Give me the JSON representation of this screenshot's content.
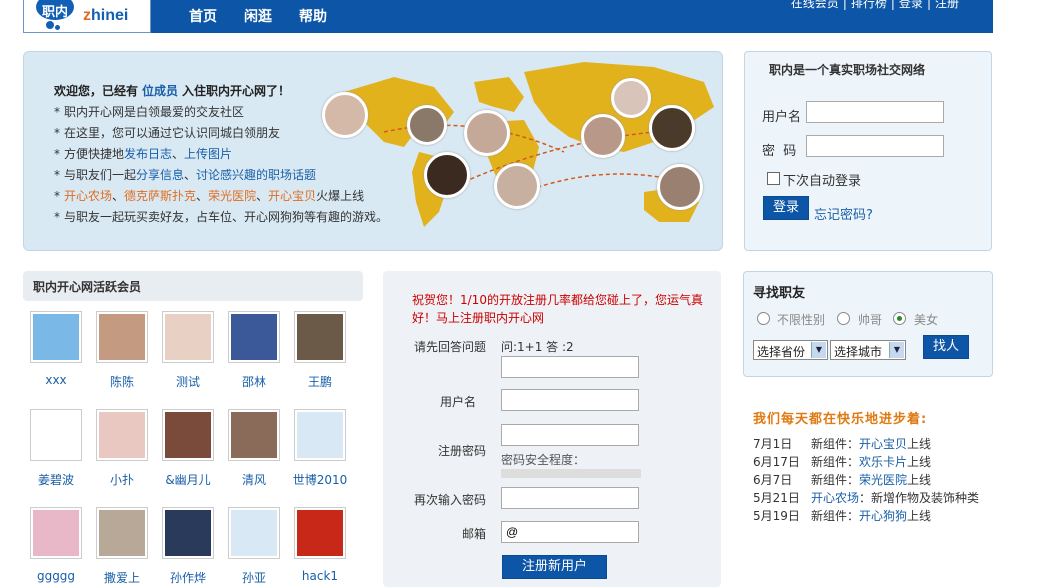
{
  "header": {
    "logo_cn": "职内",
    "logo_en_prefix": "z",
    "logo_en_rest": "hinei",
    "nav": [
      "首页",
      "闲逛",
      "帮助"
    ],
    "toplinks": [
      "在线会员",
      "排行榜",
      "登录",
      "注册"
    ]
  },
  "banner": {
    "welcome_prefix": "欢迎您，已经有",
    "welcome_count": "位成员",
    "welcome_suffix": "入住职内开心网了！",
    "bullet": "*",
    "features": [
      {
        "parts": [
          {
            "t": "职内开心网是白领最爱的交友社区",
            "c": ""
          }
        ]
      },
      {
        "parts": [
          {
            "t": "在这里，您可以通过它认识同城白领朋友",
            "c": ""
          }
        ]
      },
      {
        "parts": [
          {
            "t": "方便快捷地",
            "c": ""
          },
          {
            "t": "发布日志",
            "c": "lk"
          },
          {
            "t": "、",
            "c": ""
          },
          {
            "t": "上传图片",
            "c": "lk"
          }
        ]
      },
      {
        "parts": [
          {
            "t": "与职友们一起",
            "c": ""
          },
          {
            "t": "分享信息",
            "c": "lk"
          },
          {
            "t": "、",
            "c": ""
          },
          {
            "t": "讨论感兴趣的职场话题",
            "c": "lk"
          }
        ]
      },
      {
        "parts": [
          {
            "t": "开心农场",
            "c": "or"
          },
          {
            "t": "、",
            "c": ""
          },
          {
            "t": "德克萨斯扑克",
            "c": "or"
          },
          {
            "t": "、",
            "c": ""
          },
          {
            "t": "荣光医院",
            "c": "or"
          },
          {
            "t": "、",
            "c": ""
          },
          {
            "t": "开心宝贝",
            "c": "or"
          },
          {
            "t": "火爆上线",
            "c": ""
          }
        ]
      },
      {
        "parts": [
          {
            "t": "与职友一起玩买卖好友，占车位、开心网狗狗等有趣的游戏。",
            "c": ""
          }
        ]
      }
    ]
  },
  "login": {
    "title": "职内是一个真实职场社交网络",
    "username_label": "用户名",
    "password_label": "密  码",
    "username_value": "",
    "password_value": "",
    "auto_login": "下次自动登录",
    "login_button": "登录",
    "forgot": "忘记密码?"
  },
  "members": {
    "title": "职内开心网活跃会员",
    "list": [
      {
        "name": "xxx",
        "color": "#7ab8e8"
      },
      {
        "name": "陈陈",
        "color": "#c49a80"
      },
      {
        "name": "测试",
        "color": "#e8d0c4"
      },
      {
        "name": "邵林",
        "color": "#3b5998"
      },
      {
        "name": "王鹏",
        "color": "#6b5a48"
      },
      {
        "name": "姜碧波",
        "color": "#ffffff"
      },
      {
        "name": "小扑",
        "color": "#e8c8c0"
      },
      {
        "name": "&幽月儿",
        "color": "#7a4a3a"
      },
      {
        "name": "清风",
        "color": "#8a6a58"
      },
      {
        "name": "世博2010",
        "color": "#d8e8f4"
      },
      {
        "name": "ggggg",
        "color": "#e8b8c8"
      },
      {
        "name": "撒爱上",
        "color": "#b8a898"
      },
      {
        "name": "孙作烨",
        "color": "#2a3a5a"
      },
      {
        "name": "孙亚",
        "color": "#d8e8f4"
      },
      {
        "name": "hack1",
        "color": "#c82818"
      }
    ]
  },
  "register": {
    "congrats": "祝贺您！1/10的开放注册几率都给您碰上了，您运气真好！马上注册职内开心网",
    "question_label": "请先回答问题",
    "question_text": "问:1+1 答 :2",
    "username_label": "用户名",
    "password_label": "注册密码",
    "strength_label": "密码安全程度：",
    "confirm_label": "再次输入密码",
    "email_label": "邮箱",
    "email_value": "@",
    "submit": "注册新用户"
  },
  "find": {
    "title": "寻找职友",
    "genders": [
      "不限性别",
      "帅哥",
      "美女"
    ],
    "gender_selected": 2,
    "province": "选择省份",
    "city": "选择城市",
    "button": "找人"
  },
  "news": {
    "title": "我们每天都在快乐地进步着:",
    "items": [
      {
        "date": "7月1日",
        "parts": [
          {
            "t": "新组件：",
            "c": ""
          },
          {
            "t": "开心宝贝",
            "c": "lk"
          },
          {
            "t": "上线",
            "c": ""
          }
        ]
      },
      {
        "date": "6月17日",
        "parts": [
          {
            "t": "新组件：",
            "c": ""
          },
          {
            "t": "欢乐卡片",
            "c": "lk"
          },
          {
            "t": "上线",
            "c": ""
          }
        ]
      },
      {
        "date": "6月7日",
        "parts": [
          {
            "t": "新组件：",
            "c": ""
          },
          {
            "t": "荣光医院",
            "c": "lk"
          },
          {
            "t": "上线",
            "c": ""
          }
        ]
      },
      {
        "date": "5月21日",
        "parts": [
          {
            "t": "开心农场",
            "c": "lk"
          },
          {
            "t": "：新增作物及装饰种类",
            "c": ""
          }
        ]
      },
      {
        "date": "5月19日",
        "parts": [
          {
            "t": "新组件：",
            "c": ""
          },
          {
            "t": "开心狗狗",
            "c": "lk"
          },
          {
            "t": "上线",
            "c": ""
          }
        ]
      }
    ]
  },
  "colors": {
    "brand_blue": "#0d55a6",
    "link_blue": "#1a5fa8",
    "accent_orange": "#e06d1f",
    "alert_red": "#cc0000",
    "map_gold": "#e2b21d"
  }
}
